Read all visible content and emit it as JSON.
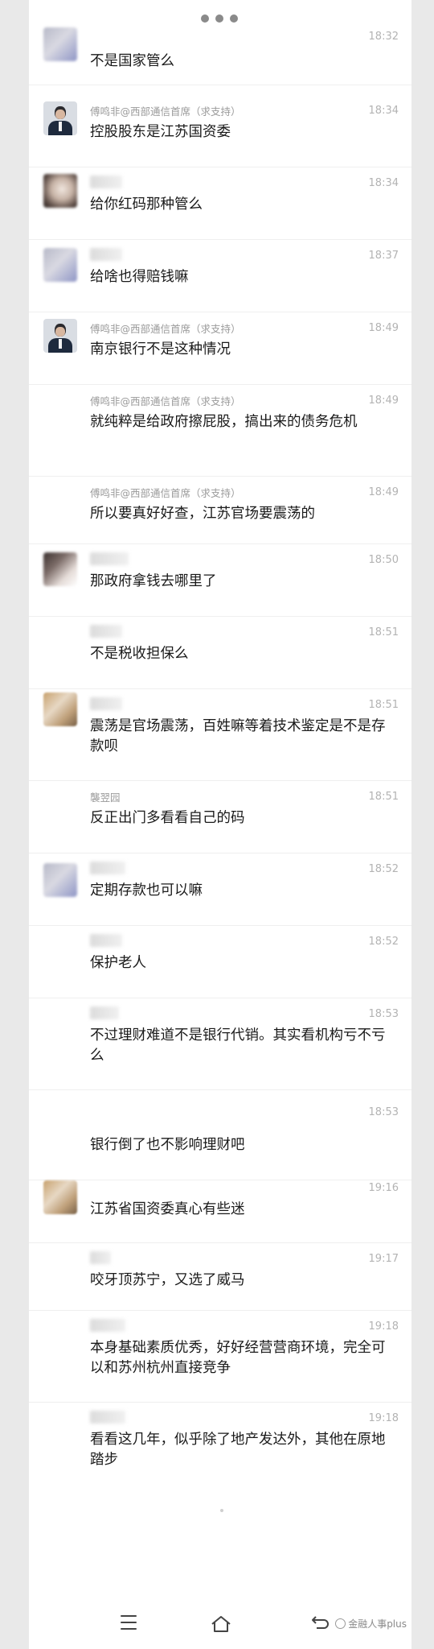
{
  "messages": [
    {
      "name": "",
      "time": "18:32",
      "text": "不是国家管么"
    },
    {
      "name": "傅鸣非@西部通信首席（求支持）",
      "time": "18:34",
      "text": "控股股东是江苏国资委"
    },
    {
      "name": "",
      "time": "18:34",
      "text": "给你红码那种管么"
    },
    {
      "name": "",
      "time": "18:37",
      "text": "给啥也得赔钱嘛"
    },
    {
      "name": "傅鸣非@西部通信首席（求支持）",
      "time": "18:49",
      "text": "南京银行不是这种情况"
    },
    {
      "name": "傅鸣非@西部通信首席（求支持）",
      "time": "18:49",
      "text": "就纯粹是给政府擦屁股，搞出来的债务危机"
    },
    {
      "name": "傅鸣非@西部通信首席（求支持）",
      "time": "18:49",
      "text": "所以要真好好查，江苏官场要震荡的"
    },
    {
      "name": "",
      "time": "18:50",
      "text": "那政府拿钱去哪里了"
    },
    {
      "name": "",
      "time": "18:51",
      "text": "不是税收担保么"
    },
    {
      "name": "",
      "time": "18:51",
      "text": "震荡是官场震荡，百姓嘛等着技术鉴定是不是存款呗"
    },
    {
      "name": "襲翌园",
      "time": "18:51",
      "text": "反正出门多看看自己的码"
    },
    {
      "name": "",
      "time": "18:52",
      "text": "定期存款也可以嘛"
    },
    {
      "name": "",
      "time": "18:52",
      "text": "保护老人"
    },
    {
      "name": "",
      "time": "18:53",
      "text": "不过理财难道不是银行代销。其实看机构亏不亏么"
    },
    {
      "name": "",
      "time": "18:53",
      "text": "银行倒了也不影响理财吧"
    },
    {
      "name": "",
      "time": "19:16",
      "text": "江苏省国资委真心有些迷"
    },
    {
      "name": "",
      "time": "19:17",
      "text": "咬牙顶苏宁，又选了威马"
    },
    {
      "name": "",
      "time": "19:18",
      "text": "本身基础素质优秀，好好经营营商环境，完全可以和苏州杭州直接竞争"
    },
    {
      "name": "",
      "time": "19:18",
      "text": "看看这几年，似乎除了地产发达外，其他在原地踏步"
    }
  ],
  "icons": {
    "more": "more-dots-icon",
    "menu": "menu-icon",
    "home": "home-icon",
    "back": "back-icon"
  },
  "watermark": "金融人事plus",
  "colors": {
    "background": "#ffffff",
    "time": "#b3b3b3",
    "name": "#9a9a9a",
    "text": "#1a1a1a"
  }
}
